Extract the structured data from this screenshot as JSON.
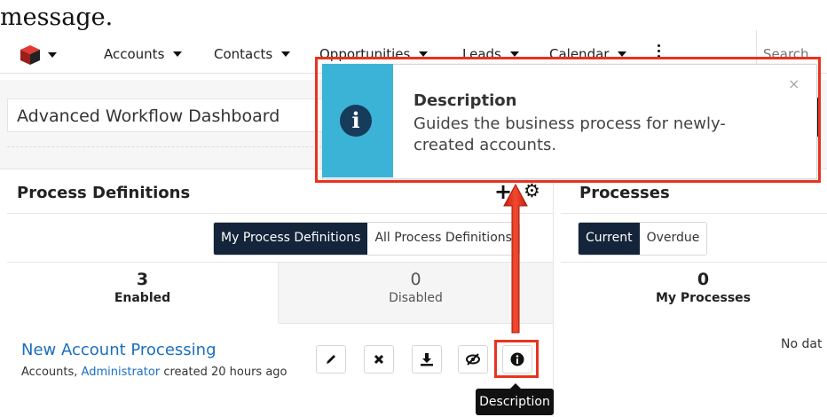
{
  "heading": "message.",
  "nav": {
    "items": [
      {
        "label": "Accounts"
      },
      {
        "label": "Contacts"
      },
      {
        "label": "Opportunities"
      },
      {
        "label": "Leads"
      },
      {
        "label": "Calendar"
      }
    ],
    "search_placeholder": "Search",
    "logo_icon": "sugar-cube-logo",
    "more_icon": "vertical-ellipsis-icon"
  },
  "dashboard": {
    "title": "Advanced Workflow Dashboard"
  },
  "popup": {
    "title": "Description",
    "body": "Guides the business process for newly-created accounts.",
    "close": "×",
    "icon": "info-icon",
    "accent_color": "#3ab3d6"
  },
  "process_definitions": {
    "title": "Process Definitions",
    "tabs": [
      {
        "label": "My Process Definitions",
        "active": true
      },
      {
        "label": "All Process Definitions",
        "active": false
      }
    ],
    "stats": [
      {
        "count": "3",
        "label": "Enabled"
      },
      {
        "count": "0",
        "label": "Disabled"
      }
    ],
    "item": {
      "name": "New Account Processing",
      "module": "Accounts,",
      "user": "Administrator",
      "created": "created 20 hours ago"
    },
    "actions": [
      {
        "name": "edit",
        "icon": "pencil-icon"
      },
      {
        "name": "delete",
        "icon": "x-icon"
      },
      {
        "name": "export",
        "icon": "download-icon"
      },
      {
        "name": "disable",
        "icon": "eye-slash-icon"
      },
      {
        "name": "description",
        "icon": "info-icon"
      }
    ],
    "tooltip": "Description"
  },
  "processes": {
    "title": "Processes",
    "tabs": [
      {
        "label": "Current",
        "active": true
      },
      {
        "label": "Overdue",
        "active": false
      }
    ],
    "stats": [
      {
        "count": "0",
        "label": "My Processes"
      }
    ],
    "empty_text": "No dat"
  },
  "colors": {
    "highlight": "#e8331f",
    "link": "#1a6fc0",
    "active_tab": "#14243a"
  }
}
